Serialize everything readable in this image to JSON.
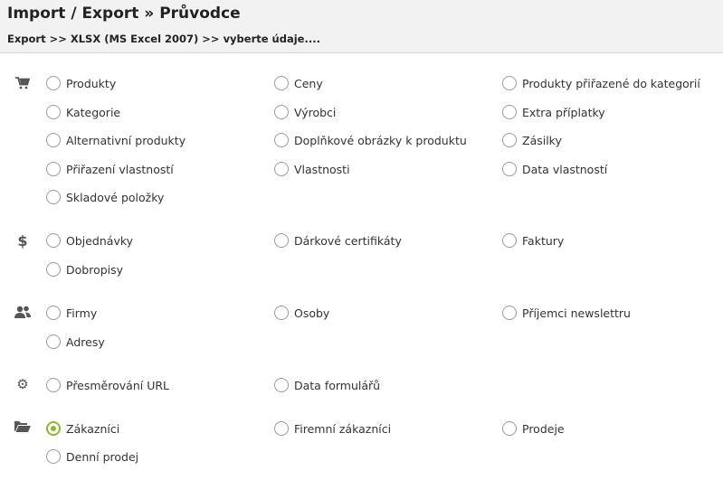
{
  "header": {
    "title": "Import / Export » Průvodce",
    "breadcrumb": "Export >> XLSX (MS Excel 2007) >> vyberte údaje...."
  },
  "groups": {
    "products": {
      "icon": "cart-icon",
      "items": [
        "Produkty",
        "Ceny",
        "Produkty přiřazené do kategorií",
        "Kategorie",
        "Výrobci",
        "Extra příplatky",
        "Alternativní produkty",
        "Doplňkové obrázky k produktu",
        "Zásilky",
        "Přiřazení vlastností",
        "Vlastnosti",
        "Data vlastností",
        "Skladové položky"
      ]
    },
    "orders": {
      "icon": "dollar-icon",
      "items": [
        "Objednávky",
        "Dárkové certifikáty",
        "Faktury",
        "Dobropisy"
      ]
    },
    "contacts": {
      "icon": "users-icon",
      "items": [
        "Firmy",
        "Osoby",
        "Příjemci newslettru",
        "Adresy"
      ]
    },
    "settings": {
      "icon": "gear-icon",
      "items": [
        "Přesměrování URL",
        "Data formulářů"
      ]
    },
    "customers": {
      "icon": "folder-open-icon",
      "items": [
        "Zákazníci",
        "Firemní zákazníci",
        "Prodeje",
        "Denní prodej"
      ]
    }
  },
  "selected": "Zákazníci",
  "accent_color": "#8cb82b"
}
